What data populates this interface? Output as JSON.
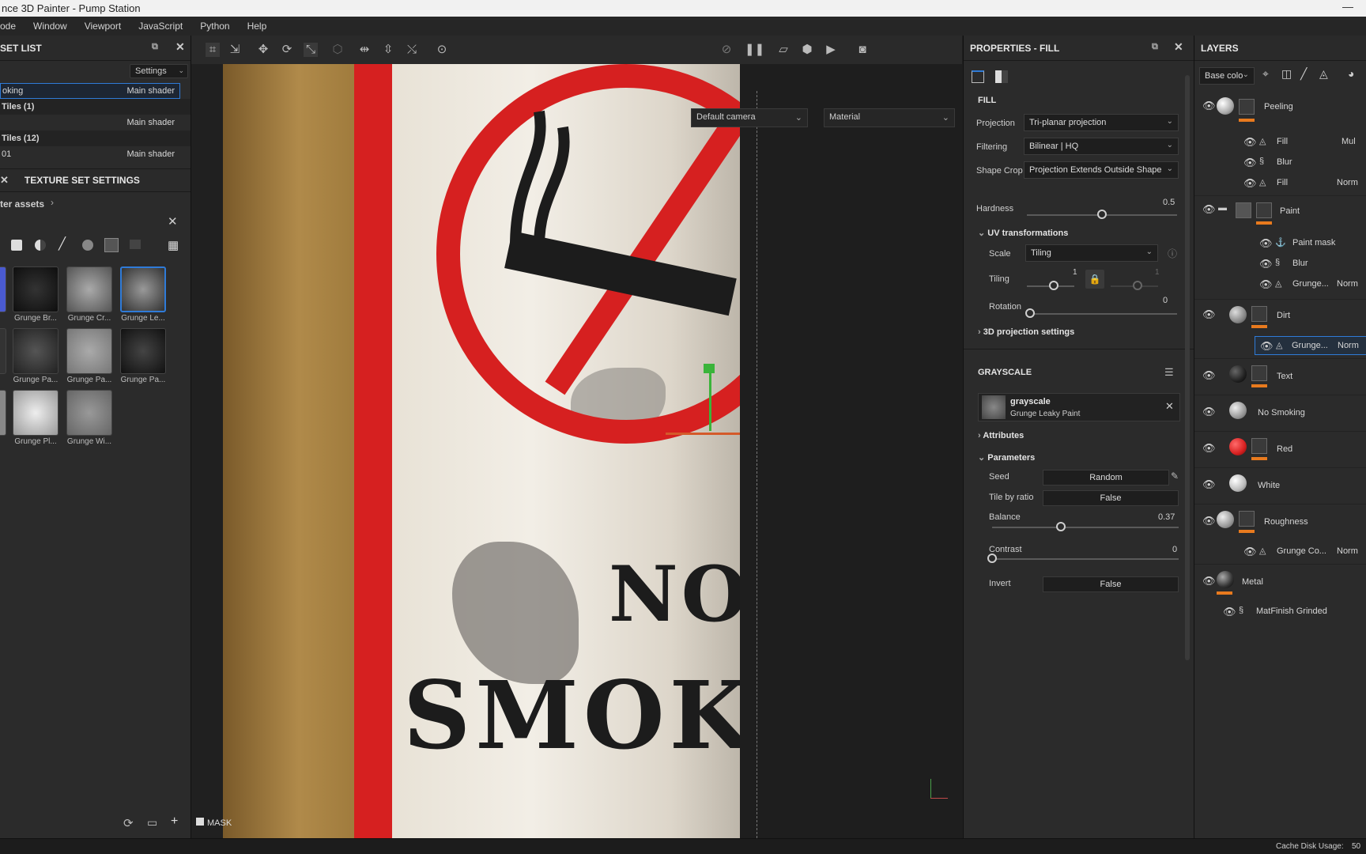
{
  "app": {
    "title": "nce 3D Painter - Pump Station",
    "min_glyph": "—"
  },
  "menu": [
    "ode",
    "Window",
    "Viewport",
    "JavaScript",
    "Python",
    "Help"
  ],
  "texture_set_list": {
    "title": "SET LIST",
    "settings_label": "Settings",
    "rows": [
      {
        "name": "oking",
        "shader": "Main shader"
      },
      {
        "name": "Tiles (1)",
        "shader": ""
      },
      {
        "name": "",
        "shader": "Main shader"
      },
      {
        "name": "Tiles (12)",
        "shader": ""
      },
      {
        "name": "01",
        "shader": "Main shader"
      }
    ]
  },
  "texture_set_settings": {
    "title": "TEXTURE SET SETTINGS"
  },
  "assets": {
    "breadcrumb": "ter assets",
    "thumbs": [
      {
        "label": "Grunge Br..."
      },
      {
        "label": "Grunge Cr..."
      },
      {
        "label": "Grunge Le..."
      },
      {
        "label": "Grunge Pa..."
      },
      {
        "label": "Grunge Pa..."
      },
      {
        "label": "Grunge Pa..."
      },
      {
        "label": "Grunge Pl..."
      },
      {
        "label": "Grunge Wi..."
      }
    ]
  },
  "viewport": {
    "camera": "Default camera",
    "channel": "Material",
    "mask_label": "MASK",
    "sign_text_1": "NO",
    "sign_text_2": "SMOKIN"
  },
  "properties": {
    "title": "PROPERTIES - FILL",
    "fill_header": "FILL",
    "projection_label": "Projection",
    "projection_value": "Tri-planar projection",
    "filtering_label": "Filtering",
    "filtering_value": "Bilinear | HQ",
    "shapecrop_label": "Shape Crop",
    "shapecrop_value": "Projection Extends Outside Shape",
    "hardness_label": "Hardness",
    "hardness_value": "0.5",
    "hardness_level": 0.5,
    "uv_header": "UV transformations",
    "scale_label": "Scale",
    "scale_value": "Tiling",
    "tiling_label": "Tiling",
    "tiling_value": "1",
    "tiling_value_2": "1",
    "rotation_label": "Rotation",
    "rotation_value": "0",
    "proj3d_header": "3D projection settings",
    "grayscale_header": "GRAYSCALE",
    "grayscale_name": "grayscale",
    "grayscale_resource": "Grunge Leaky Paint",
    "attributes_header": "Attributes",
    "parameters_header": "Parameters",
    "seed_label": "Seed",
    "seed_value": "Random",
    "tile_label": "Tile by ratio",
    "tile_value": "False",
    "balance_label": "Balance",
    "balance_value": "0.37",
    "balance_level": 0.37,
    "contrast_label": "Contrast",
    "contrast_value": "0",
    "contrast_level": 0,
    "invert_label": "Invert",
    "invert_value": "False"
  },
  "layers": {
    "title": "LAYERS",
    "channel": "Base colo",
    "items": [
      {
        "name": "Peeling"
      },
      {
        "name": "Fill",
        "blend": "Mul"
      },
      {
        "name": "Blur"
      },
      {
        "name": "Fill",
        "blend": "Norm"
      },
      {
        "name": "Paint"
      },
      {
        "name": "Paint mask"
      },
      {
        "name": "Blur"
      },
      {
        "name": "Grunge...",
        "blend": "Norm"
      },
      {
        "name": "Dirt"
      },
      {
        "name": "Grunge...",
        "blend": "Norm"
      },
      {
        "name": "Text"
      },
      {
        "name": "No Smoking"
      },
      {
        "name": "Red"
      },
      {
        "name": "White"
      },
      {
        "name": "Roughness"
      },
      {
        "name": "Grunge Co...",
        "blend": "Norm"
      },
      {
        "name": "Metal"
      },
      {
        "name": "MatFinish Grinded"
      }
    ]
  },
  "status": {
    "cache": "Cache Disk Usage:",
    "cache_value": "50"
  },
  "colors": {
    "accent": "#e87a1e",
    "selection": "#2f7bd8",
    "red_layer": "#d62020"
  }
}
